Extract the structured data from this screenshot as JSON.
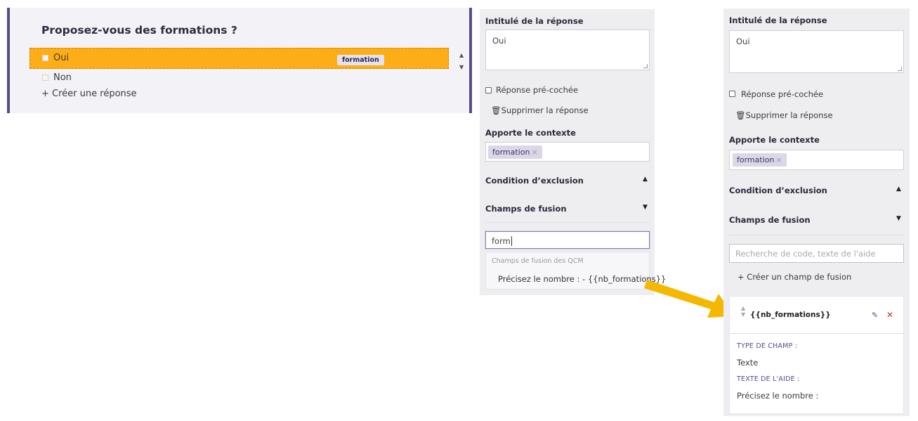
{
  "question": {
    "title": "Proposez-vous des formations ?",
    "options": [
      "Oui",
      "Non"
    ],
    "selected_tag": "formation",
    "create_answer": "Créer une réponse"
  },
  "panel_left": {
    "answer_label": "Intitulé de la réponse",
    "answer_value": "Oui",
    "prechecked": "Réponse pré-cochée",
    "delete": "Supprimer la réponse",
    "context_label": "Apporte le contexte",
    "context_chip": "formation",
    "exclusion": "Condition d’exclusion",
    "fusion": "Champs de fusion",
    "search_value": "form",
    "dropdown_group": "Champs de fusion des QCM",
    "dropdown_option": "Précisez le nombre : - {{nb_formations}}"
  },
  "panel_right": {
    "answer_label": "Intitulé de la réponse",
    "answer_value": "Oui",
    "prechecked": "Réponse pré-cochée",
    "delete": "Supprimer la réponse",
    "context_label": "Apporte le contexte",
    "context_chip": "formation",
    "exclusion": "Condition d’exclusion",
    "fusion": "Champs de fusion",
    "search_placeholder": "Recherche de code, texte de l'aide",
    "create_field": "Créer un champ de fusion",
    "field_code": "{{nb_formations}}",
    "type_label": "TYPE DE CHAMP :",
    "type_value": "Texte",
    "help_label": "TEXTE DE L'AIDE :",
    "help_value": "Précisez le nombre :"
  },
  "colors": {
    "accent": "#5a4a8a",
    "selected": "#fdad16",
    "arrow": "#f5b800"
  }
}
